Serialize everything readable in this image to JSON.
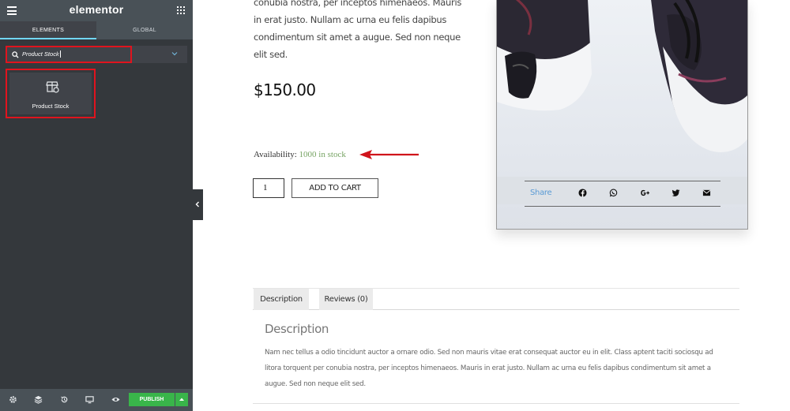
{
  "panel": {
    "logo": "elementor",
    "tabs": [
      "ELEMENTS",
      "GLOBAL"
    ],
    "search": {
      "value": "Product Stock"
    },
    "widget": {
      "label": "Product Stock"
    },
    "footer": {
      "publish_label": "PUBLISH"
    }
  },
  "product": {
    "summary": "conubia nostra, per inceptos himenaeos. Mauris in erat justo. Nullam ac urna eu felis dapibus condimentum sit amet a augue. Sed non neque elit sed.",
    "price": "$150.00",
    "availability_label": "Availability:",
    "availability_value": "1000 in stock",
    "quantity": "1",
    "add_to_cart": "ADD TO CART",
    "share_label": "Share",
    "share_icons": [
      "facebook-icon",
      "whatsapp-icon",
      "google-plus-icon",
      "twitter-icon",
      "email-icon"
    ]
  },
  "content_tabs": [
    "Description",
    "Reviews (0)"
  ],
  "description": {
    "title": "Description",
    "body": "Nam nec tellus a odio tincidunt auctor a ornare odio. Sed non mauris vitae erat consequat auctor eu in elit. Class aptent taciti sociosqu ad litora torquent per conubia nostra, per inceptos himenaeos. Mauris in erat justo. Nullam ac urna eu felis dapibus condimentum sit amet a augue. Sed non neque elit sed."
  },
  "colors": {
    "panel_bg": "#34383c",
    "header_bg": "#495157",
    "highlight_red": "#e0141e",
    "publish_green": "#39b54a",
    "stock_green": "#77a464",
    "share_blue": "#5b9bd5"
  }
}
